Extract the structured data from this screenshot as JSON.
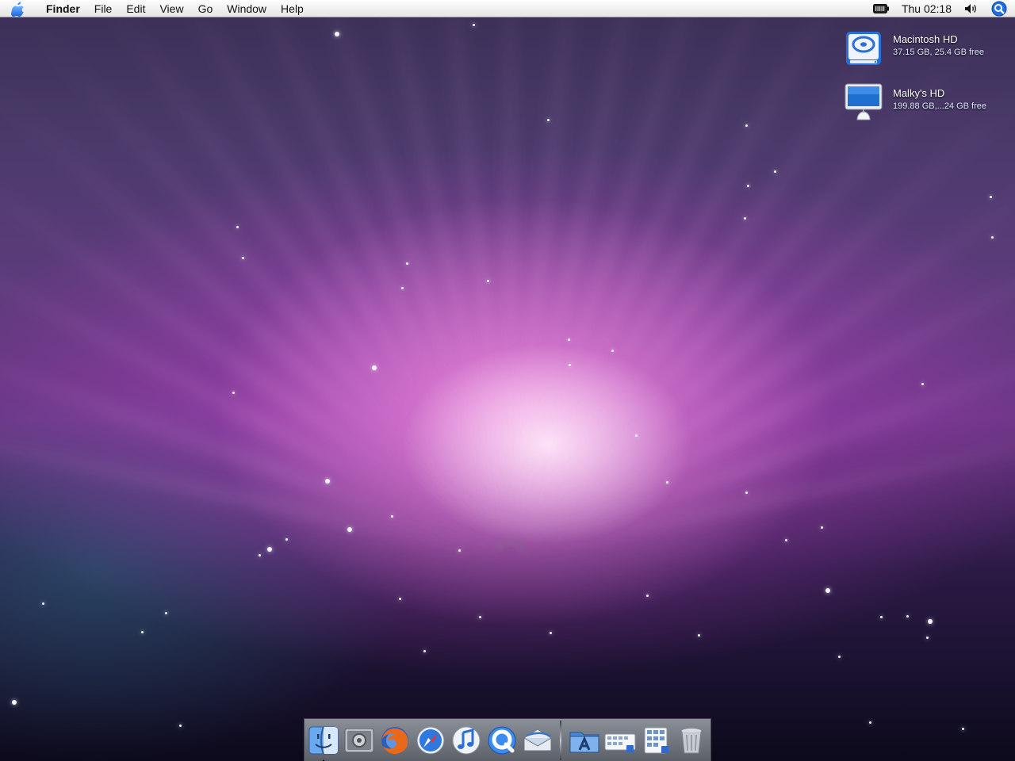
{
  "menubar": {
    "apple_icon": "apple-icon",
    "app_name": "Finder",
    "menus": [
      "File",
      "Edit",
      "View",
      "Go",
      "Window",
      "Help"
    ],
    "clock": "Thu 02:18",
    "status_icons": [
      "battery-icon",
      "volume-icon",
      "spotlight-icon"
    ]
  },
  "desktop": {
    "icons": [
      {
        "name": "Macintosh HD",
        "info": "37.15 GB, 25.4 GB free",
        "icon": "hard-drive-icon"
      },
      {
        "name": "Malky's HD",
        "info": "199.88 GB,...24 GB free",
        "icon": "network-volume-icon"
      }
    ]
  },
  "dock": {
    "apps": [
      {
        "icon": "finder-icon",
        "running": true
      },
      {
        "icon": "system-preferences-icon",
        "running": false
      },
      {
        "icon": "firefox-icon",
        "running": false
      },
      {
        "icon": "safari-icon",
        "running": false
      },
      {
        "icon": "itunes-icon",
        "running": false
      },
      {
        "icon": "quicktime-icon",
        "running": false
      },
      {
        "icon": "mail-icon",
        "running": false
      }
    ],
    "others": [
      {
        "icon": "applications-folder-icon"
      },
      {
        "icon": "documents-stack-icon"
      },
      {
        "icon": "downloads-stack-icon"
      },
      {
        "icon": "trash-icon"
      }
    ]
  }
}
